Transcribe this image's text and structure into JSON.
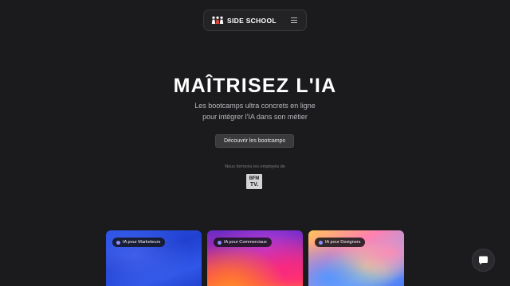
{
  "nav": {
    "brand": "SIDE SCHOOL",
    "logo_icon": "three-people-icon",
    "menu_icon": "hamburger-menu-icon"
  },
  "hero": {
    "title": "MAÎTRISEZ L'IA",
    "subtitle_line1": "Les bootcamps ultra concrets en ligne",
    "subtitle_line2": "pour intégrer l'IA dans son métier",
    "cta_label": "Découvrir les bootcamps"
  },
  "trust": {
    "text": "Nous formons les employés de",
    "logo_line1": "BFM",
    "logo_line2": "TV."
  },
  "cards": [
    {
      "tag": "IA pour Marketeurs"
    },
    {
      "tag": "IA pour Commerciaux"
    },
    {
      "tag": "IA pour Designers"
    }
  ],
  "chat": {
    "icon": "chat-bubble-icon"
  },
  "colors": {
    "background": "#1b1b1d",
    "button": "#3a3a3d",
    "tag_dot": "#8c8cff"
  }
}
